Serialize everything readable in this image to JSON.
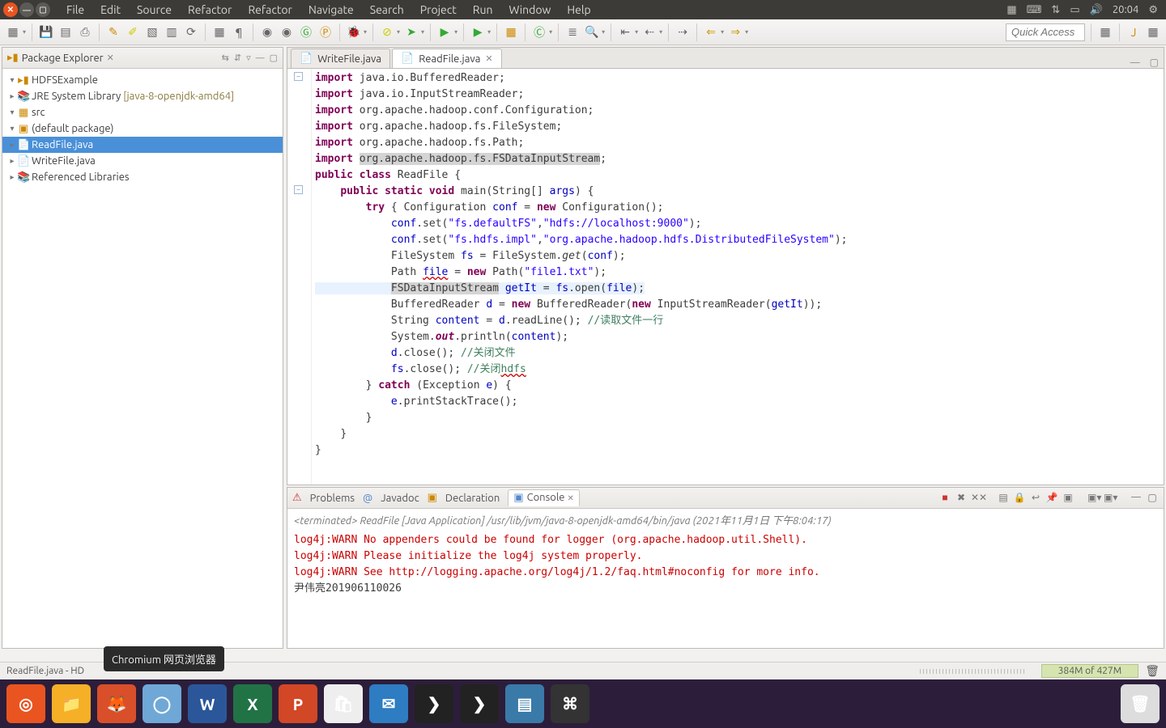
{
  "system": {
    "menus": [
      "File",
      "Edit",
      "Source",
      "Refactor",
      "Refactor",
      "Navigate",
      "Search",
      "Project",
      "Run",
      "Window",
      "Help"
    ],
    "clock": "20:04"
  },
  "toolbar": {
    "quick_access_placeholder": "Quick Access"
  },
  "package_explorer": {
    "title": "Package Explorer",
    "project": "HDFSExample",
    "jre": "JRE System Library",
    "jre_detail": "[java-8-openjdk-amd64]",
    "src": "src",
    "pkg": "(default package)",
    "file_read": "ReadFile.java",
    "file_write": "WriteFile.java",
    "ref_libs": "Referenced Libraries"
  },
  "editor": {
    "tab_inactive": "WriteFile.java",
    "tab_active": "ReadFile.java"
  },
  "code": {
    "l1a": "import",
    "l1b": " java.io.BufferedReader;",
    "l2a": "import",
    "l2b": " java.io.InputStreamReader;",
    "l3a": "import",
    "l3b": " org.apache.hadoop.conf.Configuration;",
    "l4a": "import",
    "l4b": " org.apache.hadoop.fs.FileSystem;",
    "l5a": "import",
    "l5b": " org.apache.hadoop.fs.Path;",
    "l6a": "import",
    "l6b": " ",
    "l6c": "org.apache.hadoop.fs.FSDataInputStream",
    "l6d": ";",
    "l7a": "public",
    "l7b": " ",
    "l7c": "class",
    "l7d": " ReadFile {",
    "l8a": "public",
    "l8b": " ",
    "l8c": "static",
    "l8d": " ",
    "l8e": "void",
    "l8f": " main(String[] ",
    "l8g": "args",
    "l8h": ") {",
    "l9a": "try",
    "l9b": " { Configuration ",
    "l9c": "conf",
    "l9d": " = ",
    "l9e": "new",
    "l9f": " Configuration();",
    "l10a": "conf",
    "l10b": ".set(",
    "l10c": "\"fs.defaultFS\"",
    "l10d": ",",
    "l10e": "\"hdfs://localhost:9000\"",
    "l10f": ");",
    "l11a": "conf",
    "l11b": ".set(",
    "l11c": "\"fs.hdfs.impl\"",
    "l11d": ",",
    "l11e": "\"org.apache.hadoop.hdfs.DistributedFileSystem\"",
    "l11f": ");",
    "l12a": "FileSystem ",
    "l12b": "fs",
    "l12c": " = FileSystem.",
    "l12d": "get",
    "l12e": "(",
    "l12f": "conf",
    "l12g": ");",
    "l13a": "Path ",
    "l13b": "file",
    "l13c": " = ",
    "l13d": "new",
    "l13e": " Path(",
    "l13f": "\"file1.txt\"",
    "l13g": ");",
    "l14a": "FSDataInputStream",
    "l14b": " ",
    "l14c": "getIt",
    "l14d": " = ",
    "l14e": "fs",
    "l14f": ".open(",
    "l14g": "file",
    "l14h": ");",
    "l15a": "BufferedReader ",
    "l15b": "d",
    "l15c": " = ",
    "l15d": "new",
    "l15e": " BufferedReader(",
    "l15f": "new",
    "l15g": " InputStreamReader(",
    "l15h": "getIt",
    "l15i": "));",
    "l16a": "String ",
    "l16b": "content",
    "l16c": " = ",
    "l16d": "d",
    "l16e": ".readLine(); ",
    "l16f": "//读取文件一行",
    "l17a": "System.",
    "l17b": "out",
    "l17c": ".println(",
    "l17d": "content",
    "l17e": ");",
    "l18a": "d",
    "l18b": ".close(); ",
    "l18c": "//关闭文件",
    "l19a": "fs",
    "l19b": ".close(); ",
    "l19c": "//关闭",
    "l19d": "hdfs",
    "l20a": "} ",
    "l20b": "catch",
    "l20c": " (Exception ",
    "l20d": "e",
    "l20e": ") {",
    "l21a": "e",
    "l21b": ".printStackTrace();",
    "l22": "}",
    "l23": "}",
    "l24": "}"
  },
  "bottom_tabs": {
    "problems": "Problems",
    "javadoc": "Javadoc",
    "declaration": "Declaration",
    "console": "Console"
  },
  "console": {
    "header": "<terminated> ReadFile [Java Application] /usr/lib/jvm/java-8-openjdk-amd64/bin/java (2021年11月1日 下午8:04:17)",
    "l1": "log4j:WARN No appenders could be found for logger (org.apache.hadoop.util.Shell).",
    "l2": "log4j:WARN Please initialize the log4j system properly.",
    "l3": "log4j:WARN See http://logging.apache.org/log4j/1.2/faq.html#noconfig for more info.",
    "l4": "尹伟亮201906110026"
  },
  "status": {
    "file": "ReadFile.java - HD",
    "memory": "384M of 427M"
  },
  "tooltip": "Chromium 网页浏览器",
  "dock": {
    "apps": [
      "",
      "",
      "",
      "",
      "W",
      "X",
      "P",
      "",
      "",
      "",
      "",
      "",
      "",
      ""
    ]
  }
}
